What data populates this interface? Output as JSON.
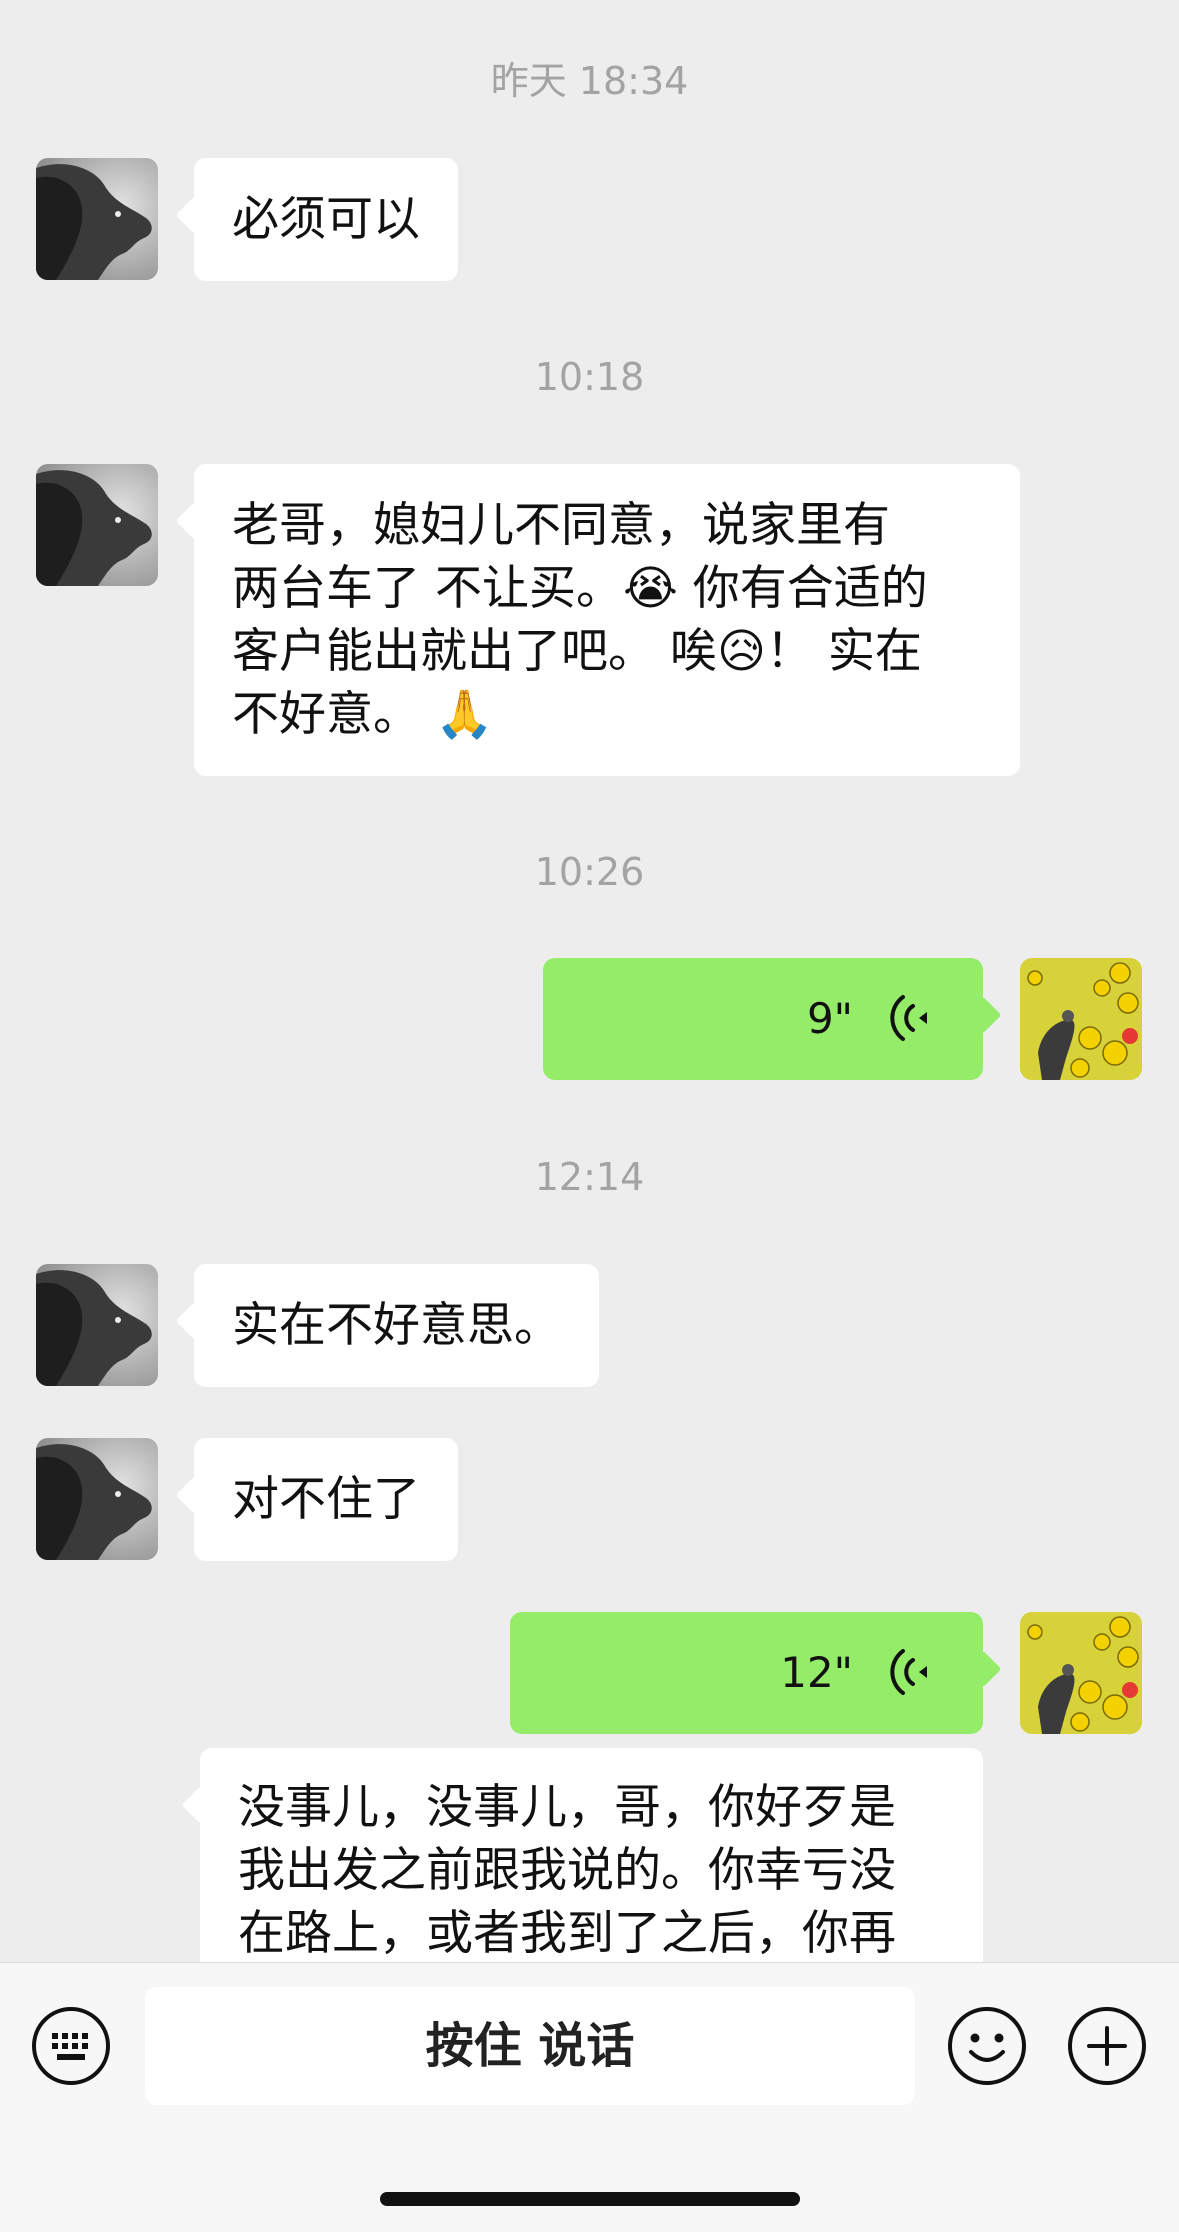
{
  "messages": [
    {
      "type": "time",
      "text": "昨天 18:34"
    },
    {
      "type": "text",
      "side": "in",
      "text": "必须可以"
    },
    {
      "type": "time",
      "text": "10:18"
    },
    {
      "type": "text",
      "side": "in",
      "lines": [
        "老哥，媳妇儿不同意，说家里有",
        "两台车了  不让买。😭 你有合适的",
        "客户能出就出了吧。 唉😥！ 实在",
        "不好意。 🙏"
      ]
    },
    {
      "type": "time",
      "text": "10:26"
    },
    {
      "type": "voice",
      "side": "out",
      "duration": "9\""
    },
    {
      "type": "time",
      "text": "12:14"
    },
    {
      "type": "text",
      "side": "in",
      "text": "实在不好意思。"
    },
    {
      "type": "text",
      "side": "in",
      "text": "对不住了"
    },
    {
      "type": "voice",
      "side": "out",
      "duration": "12\""
    },
    {
      "type": "text",
      "side": "out_partial",
      "lines": [
        "没事儿，没事儿，哥，你好歹是",
        "我出发之前跟我说的。你幸亏没",
        "在路上，或者我到了之后，你再"
      ]
    }
  ],
  "bottom_bar": {
    "keyboard_icon": "keyboard-icon",
    "hold_to_talk": "按住 说话",
    "emoji_icon": "smile-icon",
    "plus_icon": "plus-icon"
  },
  "colors": {
    "background": "#ededed",
    "incoming_bubble": "#ffffff",
    "outgoing_bubble": "#95ec69",
    "timestamp": "#a3a3a3"
  }
}
